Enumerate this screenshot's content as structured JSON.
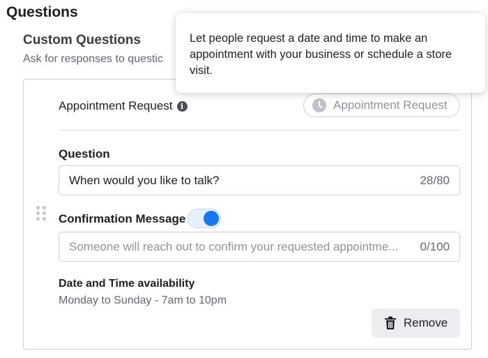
{
  "page": {
    "title": "Questions",
    "section_title": "Custom Questions",
    "section_subtitle": "Ask for responses to questic"
  },
  "question_card": {
    "type_label": "Appointment Request",
    "type_pill_label": "Appointment Request",
    "question_label": "Question",
    "question_value": "When would you like to talk?",
    "question_count": "28/80",
    "confirmation_label": "Confirmation Message",
    "confirmation_toggle_on": true,
    "confirmation_placeholder": "Someone will reach out to confirm your requested appointme...",
    "confirmation_count": "0/100",
    "availability_label": "Date and Time availability",
    "availability_value": "Monday to Sunday - 7am to 10pm",
    "remove_label": "Remove"
  },
  "tooltip": {
    "text": "Let people request a date and time to make an appointment with your business or schedule a store visit."
  },
  "icons": {
    "info": "info-icon",
    "clock": "clock-icon",
    "trash": "trash-icon",
    "drag": "drag-handle-icon"
  },
  "colors": {
    "accent": "#1877f2",
    "toggle_track": "#e7f0fd",
    "border": "#ccd0d5",
    "muted_text": "#606770",
    "button_bg": "#ebedf0"
  }
}
